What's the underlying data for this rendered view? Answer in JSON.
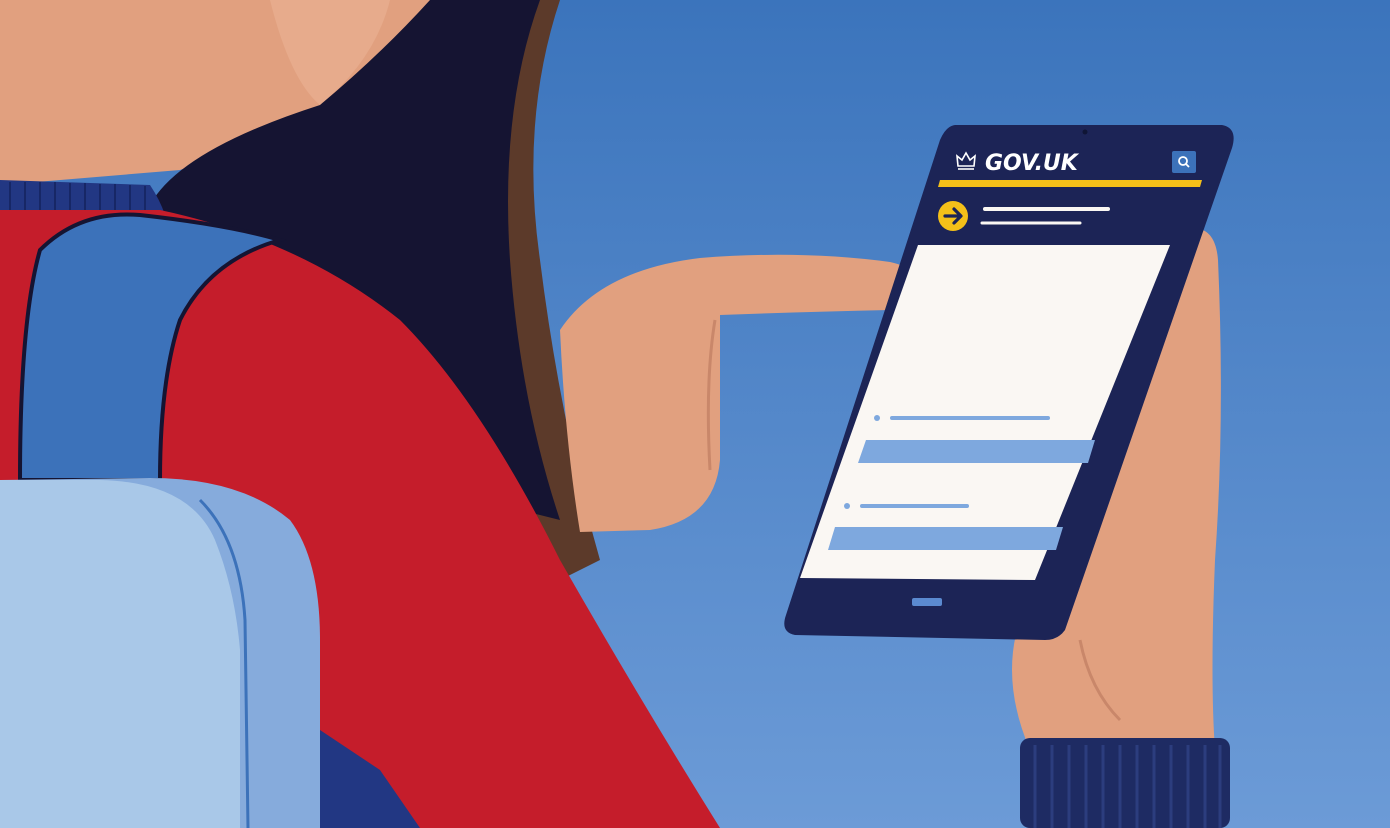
{
  "phone": {
    "brand_text": "GOV.UK"
  },
  "colors": {
    "sky_top": "#3d76bd",
    "sky_bottom": "#6a9ad6",
    "skin": "#e1a07f",
    "hair": "#151432",
    "hair_shadow": "#5c3a2a",
    "jacket_red": "#c51d2b",
    "strap_blue": "#3c72ba",
    "backpack_light": "#a9c8e8",
    "backpack_mid": "#86abdc",
    "sleeve_navy": "#1e2b63",
    "phone_body": "#1c2456",
    "phone_screen": "#faf7f3",
    "gov_yellow": "#f4c019",
    "link_blue": "#7ea8de"
  },
  "icons": {
    "crown": "crown-icon",
    "search": "search-icon",
    "arrow": "arrow-right-icon"
  }
}
